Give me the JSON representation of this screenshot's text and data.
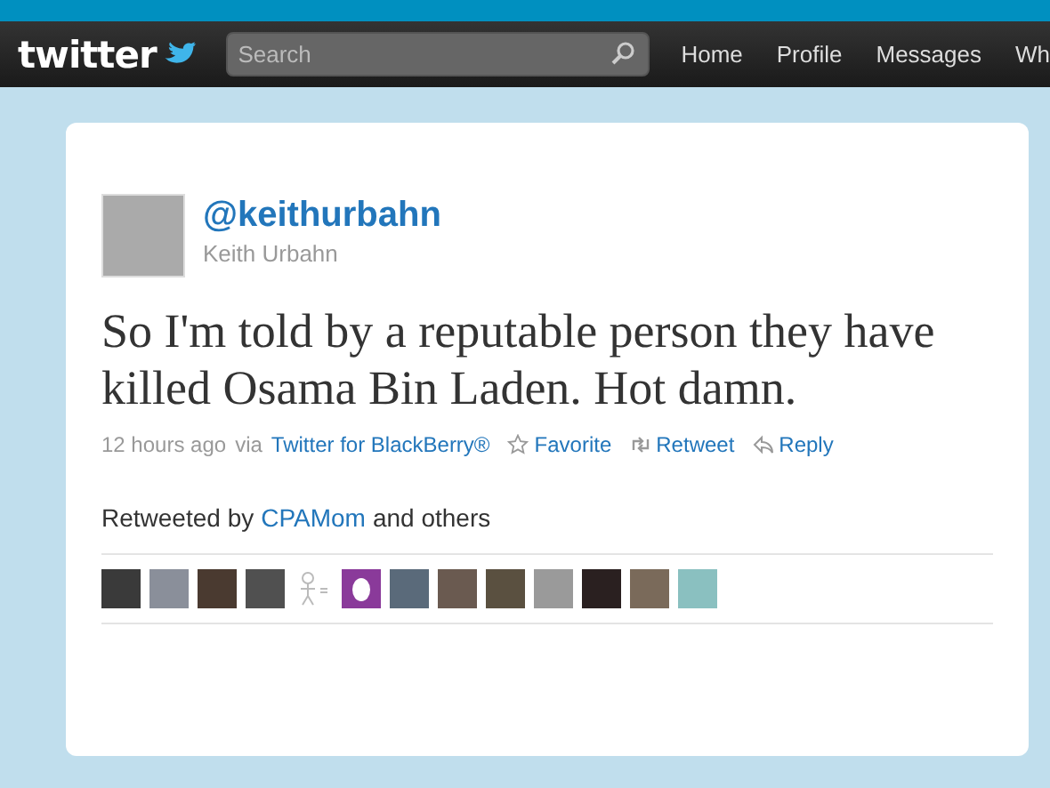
{
  "topbar": {
    "logo": "twitter",
    "search": {
      "placeholder": "Search"
    },
    "nav": [
      {
        "label": "Home"
      },
      {
        "label": "Profile"
      },
      {
        "label": "Messages"
      },
      {
        "label": "Wh"
      }
    ]
  },
  "tweet": {
    "handle": "@keithurbahn",
    "name": "Keith Urbahn",
    "text": "So I'm told by a reputable person they have killed Osama Bin Laden. Hot damn.",
    "time": "12 hours ago",
    "via": "via",
    "source": "Twitter for BlackBerry®",
    "actions": [
      {
        "kind": "favorite",
        "label": "Favorite"
      },
      {
        "kind": "retweet",
        "label": "Retweet"
      },
      {
        "kind": "reply",
        "label": "Reply"
      }
    ],
    "retweeted_by": {
      "prefix": "Retweeted by",
      "user": "CPAMom",
      "suffix": "and others"
    },
    "retweeters": [
      {
        "kind": "photo"
      },
      {
        "kind": "photo"
      },
      {
        "kind": "photo"
      },
      {
        "kind": "photo"
      },
      {
        "kind": "sketch"
      },
      {
        "kind": "egg"
      },
      {
        "kind": "photo"
      },
      {
        "kind": "photo"
      },
      {
        "kind": "photo"
      },
      {
        "kind": "photo"
      },
      {
        "kind": "photo"
      },
      {
        "kind": "photo"
      },
      {
        "kind": "photo"
      }
    ]
  }
}
